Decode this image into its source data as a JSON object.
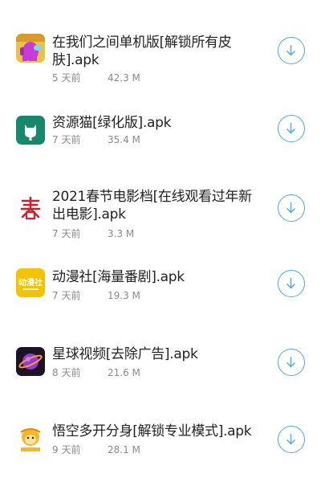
{
  "items": [
    {
      "name": "在我们之间单机版[解锁所有皮肤].apk",
      "time": "5 天前",
      "size": "42.3 M",
      "icon": "among-us-crewmate-icon"
    },
    {
      "name": "资源猫[绿化版].apk",
      "time": "7 天前",
      "size": "35.4 M",
      "icon": "resource-cat-icon"
    },
    {
      "name": "2021春节电影档[在线观看过年新出电影].apk",
      "time": "7 天前",
      "size": "3.3 M",
      "icon": "spring-character-icon"
    },
    {
      "name": "动漫社[海量番剧].apk",
      "time": "7 天前",
      "size": "19.3 M",
      "icon": "anime-club-icon"
    },
    {
      "name": "星球视频[去除广告].apk",
      "time": "8 天前",
      "size": "21.6 M",
      "icon": "planet-video-icon"
    },
    {
      "name": "悟空多开分身[解锁专业模式].apk",
      "time": "9 天前",
      "size": "28.1 M",
      "icon": "wukong-icon"
    }
  ],
  "colors": {
    "accent": "#4aa8f0",
    "meta_text": "#8a8a8a",
    "title_text": "#222222"
  }
}
